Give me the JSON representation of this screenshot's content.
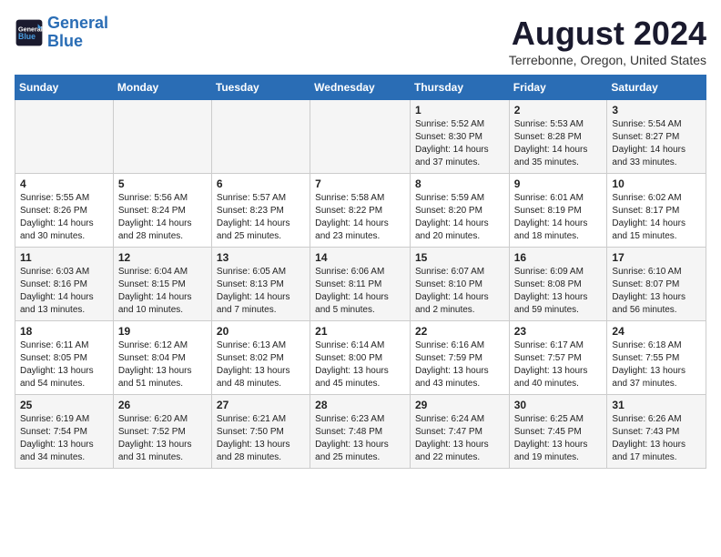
{
  "header": {
    "logo_line1": "General",
    "logo_line2": "Blue",
    "title": "August 2024",
    "subtitle": "Terrebonne, Oregon, United States"
  },
  "weekdays": [
    "Sunday",
    "Monday",
    "Tuesday",
    "Wednesday",
    "Thursday",
    "Friday",
    "Saturday"
  ],
  "weeks": [
    [
      {
        "day": "",
        "text": ""
      },
      {
        "day": "",
        "text": ""
      },
      {
        "day": "",
        "text": ""
      },
      {
        "day": "",
        "text": ""
      },
      {
        "day": "1",
        "text": "Sunrise: 5:52 AM\nSunset: 8:30 PM\nDaylight: 14 hours\nand 37 minutes."
      },
      {
        "day": "2",
        "text": "Sunrise: 5:53 AM\nSunset: 8:28 PM\nDaylight: 14 hours\nand 35 minutes."
      },
      {
        "day": "3",
        "text": "Sunrise: 5:54 AM\nSunset: 8:27 PM\nDaylight: 14 hours\nand 33 minutes."
      }
    ],
    [
      {
        "day": "4",
        "text": "Sunrise: 5:55 AM\nSunset: 8:26 PM\nDaylight: 14 hours\nand 30 minutes."
      },
      {
        "day": "5",
        "text": "Sunrise: 5:56 AM\nSunset: 8:24 PM\nDaylight: 14 hours\nand 28 minutes."
      },
      {
        "day": "6",
        "text": "Sunrise: 5:57 AM\nSunset: 8:23 PM\nDaylight: 14 hours\nand 25 minutes."
      },
      {
        "day": "7",
        "text": "Sunrise: 5:58 AM\nSunset: 8:22 PM\nDaylight: 14 hours\nand 23 minutes."
      },
      {
        "day": "8",
        "text": "Sunrise: 5:59 AM\nSunset: 8:20 PM\nDaylight: 14 hours\nand 20 minutes."
      },
      {
        "day": "9",
        "text": "Sunrise: 6:01 AM\nSunset: 8:19 PM\nDaylight: 14 hours\nand 18 minutes."
      },
      {
        "day": "10",
        "text": "Sunrise: 6:02 AM\nSunset: 8:17 PM\nDaylight: 14 hours\nand 15 minutes."
      }
    ],
    [
      {
        "day": "11",
        "text": "Sunrise: 6:03 AM\nSunset: 8:16 PM\nDaylight: 14 hours\nand 13 minutes."
      },
      {
        "day": "12",
        "text": "Sunrise: 6:04 AM\nSunset: 8:15 PM\nDaylight: 14 hours\nand 10 minutes."
      },
      {
        "day": "13",
        "text": "Sunrise: 6:05 AM\nSunset: 8:13 PM\nDaylight: 14 hours\nand 7 minutes."
      },
      {
        "day": "14",
        "text": "Sunrise: 6:06 AM\nSunset: 8:11 PM\nDaylight: 14 hours\nand 5 minutes."
      },
      {
        "day": "15",
        "text": "Sunrise: 6:07 AM\nSunset: 8:10 PM\nDaylight: 14 hours\nand 2 minutes."
      },
      {
        "day": "16",
        "text": "Sunrise: 6:09 AM\nSunset: 8:08 PM\nDaylight: 13 hours\nand 59 minutes."
      },
      {
        "day": "17",
        "text": "Sunrise: 6:10 AM\nSunset: 8:07 PM\nDaylight: 13 hours\nand 56 minutes."
      }
    ],
    [
      {
        "day": "18",
        "text": "Sunrise: 6:11 AM\nSunset: 8:05 PM\nDaylight: 13 hours\nand 54 minutes."
      },
      {
        "day": "19",
        "text": "Sunrise: 6:12 AM\nSunset: 8:04 PM\nDaylight: 13 hours\nand 51 minutes."
      },
      {
        "day": "20",
        "text": "Sunrise: 6:13 AM\nSunset: 8:02 PM\nDaylight: 13 hours\nand 48 minutes."
      },
      {
        "day": "21",
        "text": "Sunrise: 6:14 AM\nSunset: 8:00 PM\nDaylight: 13 hours\nand 45 minutes."
      },
      {
        "day": "22",
        "text": "Sunrise: 6:16 AM\nSunset: 7:59 PM\nDaylight: 13 hours\nand 43 minutes."
      },
      {
        "day": "23",
        "text": "Sunrise: 6:17 AM\nSunset: 7:57 PM\nDaylight: 13 hours\nand 40 minutes."
      },
      {
        "day": "24",
        "text": "Sunrise: 6:18 AM\nSunset: 7:55 PM\nDaylight: 13 hours\nand 37 minutes."
      }
    ],
    [
      {
        "day": "25",
        "text": "Sunrise: 6:19 AM\nSunset: 7:54 PM\nDaylight: 13 hours\nand 34 minutes."
      },
      {
        "day": "26",
        "text": "Sunrise: 6:20 AM\nSunset: 7:52 PM\nDaylight: 13 hours\nand 31 minutes."
      },
      {
        "day": "27",
        "text": "Sunrise: 6:21 AM\nSunset: 7:50 PM\nDaylight: 13 hours\nand 28 minutes."
      },
      {
        "day": "28",
        "text": "Sunrise: 6:23 AM\nSunset: 7:48 PM\nDaylight: 13 hours\nand 25 minutes."
      },
      {
        "day": "29",
        "text": "Sunrise: 6:24 AM\nSunset: 7:47 PM\nDaylight: 13 hours\nand 22 minutes."
      },
      {
        "day": "30",
        "text": "Sunrise: 6:25 AM\nSunset: 7:45 PM\nDaylight: 13 hours\nand 19 minutes."
      },
      {
        "day": "31",
        "text": "Sunrise: 6:26 AM\nSunset: 7:43 PM\nDaylight: 13 hours\nand 17 minutes."
      }
    ]
  ]
}
